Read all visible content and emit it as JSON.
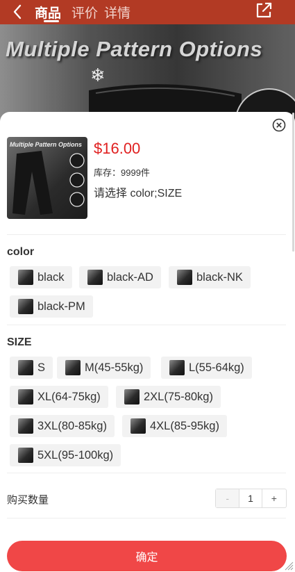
{
  "header": {
    "tabs": [
      {
        "label": "商品",
        "active": true
      },
      {
        "label": "评价",
        "active": false
      },
      {
        "label": "详情",
        "active": false
      }
    ]
  },
  "banner": {
    "title": "Multiple Pattern Options"
  },
  "product": {
    "thumb_title": "Multiple Pattern Options",
    "price": "$16.00",
    "stock": "库存：9999件",
    "prompt": "请选择 color;SIZE"
  },
  "color_section": {
    "title": "color",
    "options": [
      "black",
      "black-AD",
      "black-NK",
      "black-PM"
    ]
  },
  "size_section": {
    "title": "SIZE",
    "options": [
      "S",
      "M(45-55kg)",
      "L(55-64kg)",
      "XL(64-75kg)",
      "2XL(75-80kg)",
      "3XL(80-85kg)",
      "4XL(85-95kg)",
      "5XL(95-100kg)"
    ]
  },
  "quantity": {
    "label": "购买数量",
    "minus": "-",
    "value": "1",
    "plus": "+"
  },
  "confirm_label": "确定",
  "colors": {
    "header": "#b23a24",
    "price": "#e02020",
    "confirm": "#f04747"
  }
}
